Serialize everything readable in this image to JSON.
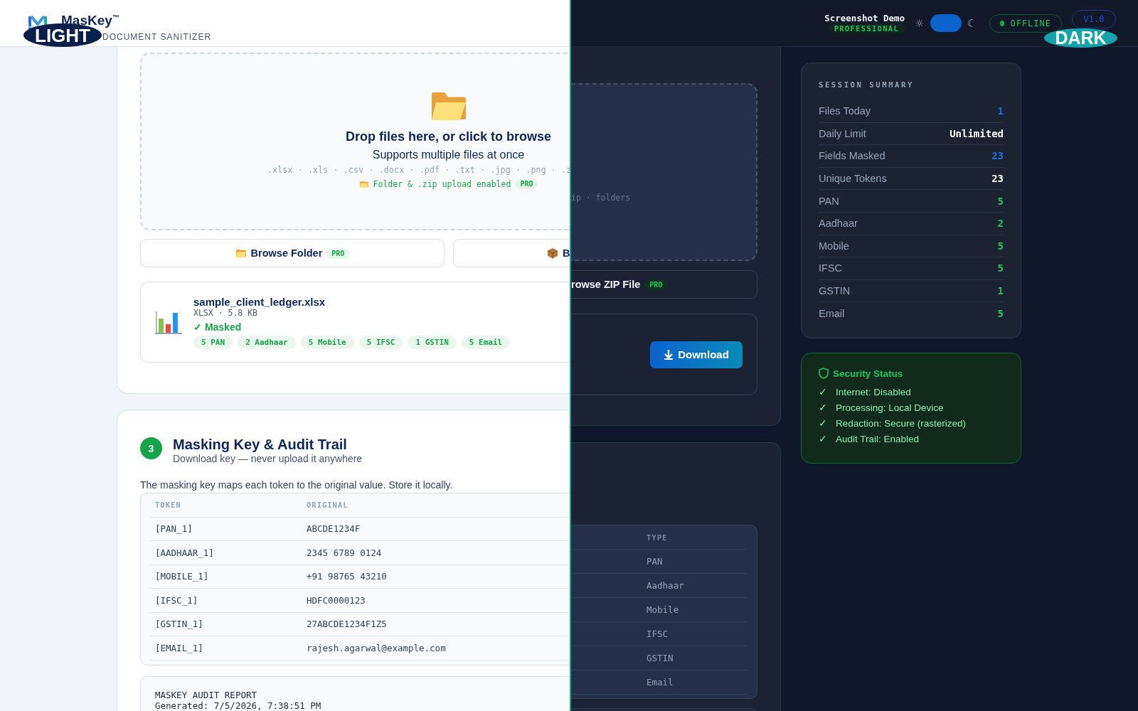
{
  "light_view": {
    "badge": "LIGHT",
    "brand": {
      "name": "MasKey",
      "trademark": "™",
      "tagline": "DOCUMENT SANITIZER"
    },
    "upload": {
      "title": "Drop files here, or click to browse",
      "subtitle": "Supports multiple files at once",
      "formats": ".xlsx · .xls · .csv · .docx · .pdf · .txt · .jpg · .png · .z",
      "pro_note": "Folder & .zip upload enabled",
      "pro_badge": "PRO"
    },
    "buttons": [
      {
        "kind": "folder",
        "label": "Browse Folder",
        "badge": "PRO"
      },
      {
        "kind": "box",
        "label": "B"
      }
    ],
    "file": {
      "name": "sample_client_ledger.xlsx",
      "meta": "XLSX · 5.8 KB",
      "status": "✓ Masked",
      "chips": [
        "5 PAN",
        "2 Aadhaar",
        "5 Mobile",
        "5 IFSC",
        "1 GSTIN",
        "5 Email"
      ]
    },
    "step": {
      "number": "3",
      "title": "Masking Key & Audit Trail",
      "subtitle": "Download key — never upload it anywhere",
      "note": "The masking key maps each token to the original value. Store it locally."
    },
    "key_table": {
      "columns": [
        "TOKEN",
        "ORIGINAL"
      ],
      "rows": [
        {
          "token": "[PAN_1]",
          "original": "ABCDE1234F"
        },
        {
          "token": "[AADHAAR_1]",
          "original": "2345 6789 0124"
        },
        {
          "token": "[MOBILE_1]",
          "original": "+91 98765 43210"
        },
        {
          "token": "[IFSC_1]",
          "original": "HDFC0000123"
        },
        {
          "token": "[GSTIN_1]",
          "original": "27ABCDE1234F1Z5"
        },
        {
          "token": "[EMAIL_1]",
          "original": "rajesh.agarwal@example.com"
        }
      ]
    },
    "audit": {
      "lines": [
        "MASKEY AUDIT REPORT",
        "Generated: 7/5/2026, 7:38:51 PM"
      ]
    }
  },
  "dark_view": {
    "badge": "DARK",
    "user": {
      "name": "Screenshot Demo",
      "plan": "PROFESSIONAL"
    },
    "theme_toggle": {
      "sun": "☼",
      "moon": "☾",
      "on": true
    },
    "status": "OFFLINE",
    "version": "V1.0",
    "upload": {
      "formats_tail": "ip · folders"
    },
    "zip_button": {
      "label": "rowse ZIP File",
      "badge": "PRO"
    },
    "download_button": "Download",
    "type_column": {
      "header": "TYPE",
      "rows": [
        "PAN",
        "Aadhaar",
        "Mobile",
        "IFSC",
        "GSTIN",
        "Email"
      ]
    },
    "session_summary": {
      "title": "SESSION SUMMARY",
      "rows": [
        {
          "label": "Files Today",
          "value": "1",
          "color": "#1a6fe0"
        },
        {
          "label": "Daily Limit",
          "value": "Unlimited",
          "color": "#ffffff"
        },
        {
          "label": "Fields Masked",
          "value": "23",
          "color": "#1a6fe0"
        },
        {
          "label": "Unique Tokens",
          "value": "23",
          "color": "#ffffff"
        },
        {
          "label": "PAN",
          "value": "5",
          "color": "#22c55e"
        },
        {
          "label": "Aadhaar",
          "value": "2",
          "color": "#22c55e"
        },
        {
          "label": "Mobile",
          "value": "5",
          "color": "#22c55e"
        },
        {
          "label": "IFSC",
          "value": "5",
          "color": "#22c55e"
        },
        {
          "label": "GSTIN",
          "value": "1",
          "color": "#22c55e"
        },
        {
          "label": "Email",
          "value": "5",
          "color": "#22c55e"
        }
      ]
    },
    "security": {
      "title": "Security Status",
      "items": [
        {
          "mark": "✓",
          "text": "Internet: Disabled"
        },
        {
          "mark": "✓",
          "text": "Processing: Local Device"
        },
        {
          "mark": "✓",
          "text": "Redaction: Secure (rasterized)"
        },
        {
          "mark": "✓",
          "text": "Audit Trail: Enabled"
        }
      ]
    }
  }
}
